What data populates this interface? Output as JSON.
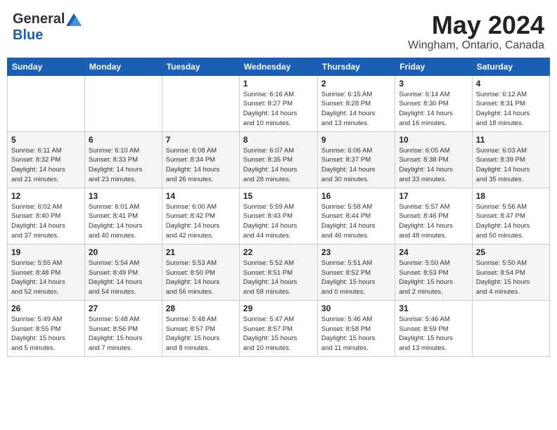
{
  "header": {
    "logo_general": "General",
    "logo_blue": "Blue",
    "month_title": "May 2024",
    "location": "Wingham, Ontario, Canada"
  },
  "weekdays": [
    "Sunday",
    "Monday",
    "Tuesday",
    "Wednesday",
    "Thursday",
    "Friday",
    "Saturday"
  ],
  "weeks": [
    [
      {
        "day": "",
        "info": ""
      },
      {
        "day": "",
        "info": ""
      },
      {
        "day": "",
        "info": ""
      },
      {
        "day": "1",
        "info": "Sunrise: 6:16 AM\nSunset: 8:27 PM\nDaylight: 14 hours\nand 10 minutes."
      },
      {
        "day": "2",
        "info": "Sunrise: 6:15 AM\nSunset: 8:28 PM\nDaylight: 14 hours\nand 13 minutes."
      },
      {
        "day": "3",
        "info": "Sunrise: 6:14 AM\nSunset: 8:30 PM\nDaylight: 14 hours\nand 16 minutes."
      },
      {
        "day": "4",
        "info": "Sunrise: 6:12 AM\nSunset: 8:31 PM\nDaylight: 14 hours\nand 18 minutes."
      }
    ],
    [
      {
        "day": "5",
        "info": "Sunrise: 6:11 AM\nSunset: 8:32 PM\nDaylight: 14 hours\nand 21 minutes."
      },
      {
        "day": "6",
        "info": "Sunrise: 6:10 AM\nSunset: 8:33 PM\nDaylight: 14 hours\nand 23 minutes."
      },
      {
        "day": "7",
        "info": "Sunrise: 6:08 AM\nSunset: 8:34 PM\nDaylight: 14 hours\nand 26 minutes."
      },
      {
        "day": "8",
        "info": "Sunrise: 6:07 AM\nSunset: 8:35 PM\nDaylight: 14 hours\nand 28 minutes."
      },
      {
        "day": "9",
        "info": "Sunrise: 6:06 AM\nSunset: 8:37 PM\nDaylight: 14 hours\nand 30 minutes."
      },
      {
        "day": "10",
        "info": "Sunrise: 6:05 AM\nSunset: 8:38 PM\nDaylight: 14 hours\nand 33 minutes."
      },
      {
        "day": "11",
        "info": "Sunrise: 6:03 AM\nSunset: 8:39 PM\nDaylight: 14 hours\nand 35 minutes."
      }
    ],
    [
      {
        "day": "12",
        "info": "Sunrise: 6:02 AM\nSunset: 8:40 PM\nDaylight: 14 hours\nand 37 minutes."
      },
      {
        "day": "13",
        "info": "Sunrise: 6:01 AM\nSunset: 8:41 PM\nDaylight: 14 hours\nand 40 minutes."
      },
      {
        "day": "14",
        "info": "Sunrise: 6:00 AM\nSunset: 8:42 PM\nDaylight: 14 hours\nand 42 minutes."
      },
      {
        "day": "15",
        "info": "Sunrise: 5:59 AM\nSunset: 8:43 PM\nDaylight: 14 hours\nand 44 minutes."
      },
      {
        "day": "16",
        "info": "Sunrise: 5:58 AM\nSunset: 8:44 PM\nDaylight: 14 hours\nand 46 minutes."
      },
      {
        "day": "17",
        "info": "Sunrise: 5:57 AM\nSunset: 8:46 PM\nDaylight: 14 hours\nand 48 minutes."
      },
      {
        "day": "18",
        "info": "Sunrise: 5:56 AM\nSunset: 8:47 PM\nDaylight: 14 hours\nand 50 minutes."
      }
    ],
    [
      {
        "day": "19",
        "info": "Sunrise: 5:55 AM\nSunset: 8:48 PM\nDaylight: 14 hours\nand 52 minutes."
      },
      {
        "day": "20",
        "info": "Sunrise: 5:54 AM\nSunset: 8:49 PM\nDaylight: 14 hours\nand 54 minutes."
      },
      {
        "day": "21",
        "info": "Sunrise: 5:53 AM\nSunset: 8:50 PM\nDaylight: 14 hours\nand 56 minutes."
      },
      {
        "day": "22",
        "info": "Sunrise: 5:52 AM\nSunset: 8:51 PM\nDaylight: 14 hours\nand 58 minutes."
      },
      {
        "day": "23",
        "info": "Sunrise: 5:51 AM\nSunset: 8:52 PM\nDaylight: 15 hours\nand 0 minutes."
      },
      {
        "day": "24",
        "info": "Sunrise: 5:50 AM\nSunset: 8:53 PM\nDaylight: 15 hours\nand 2 minutes."
      },
      {
        "day": "25",
        "info": "Sunrise: 5:50 AM\nSunset: 8:54 PM\nDaylight: 15 hours\nand 4 minutes."
      }
    ],
    [
      {
        "day": "26",
        "info": "Sunrise: 5:49 AM\nSunset: 8:55 PM\nDaylight: 15 hours\nand 5 minutes."
      },
      {
        "day": "27",
        "info": "Sunrise: 5:48 AM\nSunset: 8:56 PM\nDaylight: 15 hours\nand 7 minutes."
      },
      {
        "day": "28",
        "info": "Sunrise: 5:48 AM\nSunset: 8:57 PM\nDaylight: 15 hours\nand 8 minutes."
      },
      {
        "day": "29",
        "info": "Sunrise: 5:47 AM\nSunset: 8:57 PM\nDaylight: 15 hours\nand 10 minutes."
      },
      {
        "day": "30",
        "info": "Sunrise: 5:46 AM\nSunset: 8:58 PM\nDaylight: 15 hours\nand 11 minutes."
      },
      {
        "day": "31",
        "info": "Sunrise: 5:46 AM\nSunset: 8:59 PM\nDaylight: 15 hours\nand 13 minutes."
      },
      {
        "day": "",
        "info": ""
      }
    ]
  ]
}
